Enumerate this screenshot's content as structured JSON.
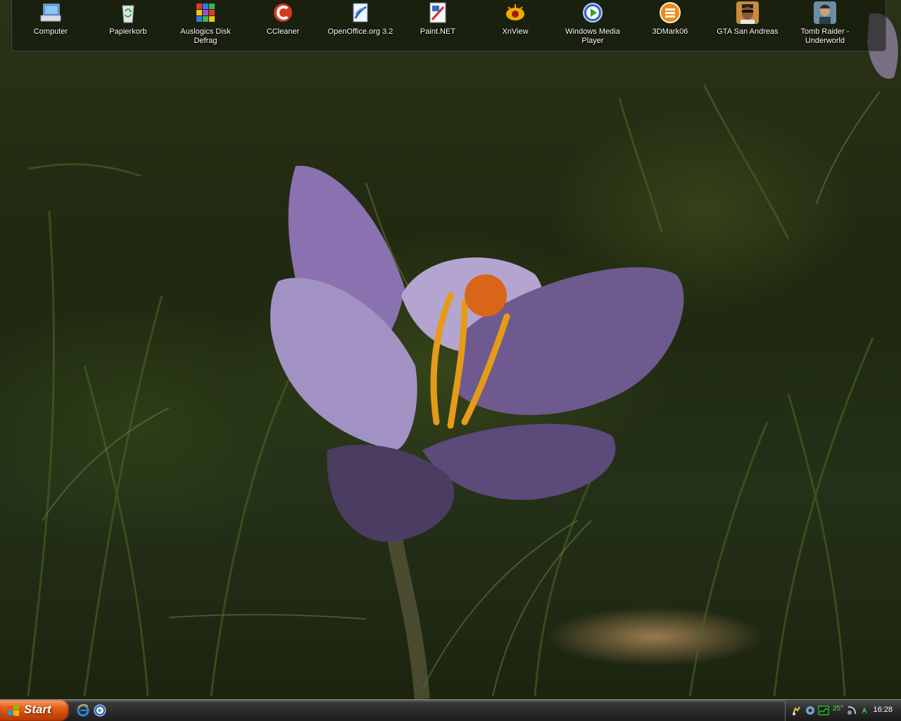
{
  "desktop": {
    "icons": [
      {
        "label": "Computer",
        "icon": "computer-icon"
      },
      {
        "label": "Papierkorb",
        "icon": "recycle-bin-icon"
      },
      {
        "label": "Auslogics Disk Defrag",
        "icon": "disk-defrag-icon"
      },
      {
        "label": "CCleaner",
        "icon": "ccleaner-icon"
      },
      {
        "label": "OpenOffice.org 3.2",
        "icon": "openoffice-icon"
      },
      {
        "label": "Paint.NET",
        "icon": "paintnet-icon"
      },
      {
        "label": "XnView",
        "icon": "xnview-icon"
      },
      {
        "label": "Windows Media Player",
        "icon": "media-player-icon"
      },
      {
        "label": "3DMark06",
        "icon": "3dmark-icon"
      },
      {
        "label": "GTA San Andreas",
        "icon": "gta-icon"
      },
      {
        "label": "Tomb Raider - Underworld",
        "icon": "tomb-raider-icon"
      }
    ]
  },
  "taskbar": {
    "start_label": "Start",
    "quick_launch": [
      {
        "icon": "internet-explorer-icon"
      },
      {
        "icon": "media-player-icon"
      }
    ],
    "tray": {
      "temperature": "25°",
      "clock": "16:28"
    }
  },
  "colors": {
    "start_button": "#d9531a",
    "taskbar": "#2c2c2c",
    "tray_temp": "#4ee04e"
  }
}
